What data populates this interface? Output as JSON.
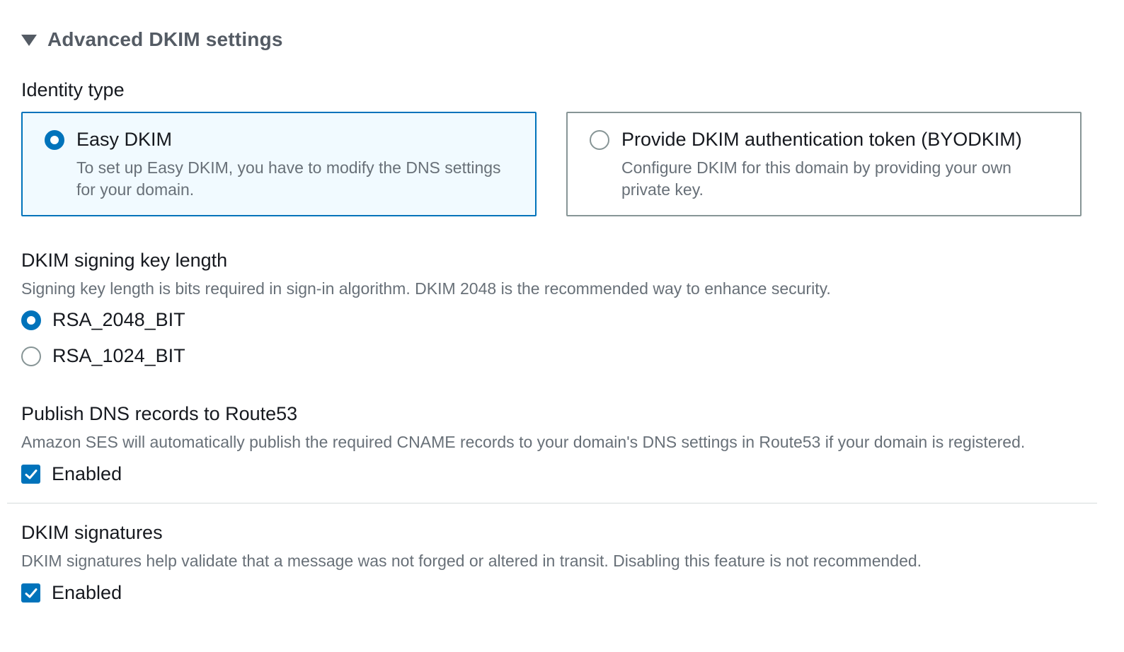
{
  "section": {
    "title": "Advanced DKIM settings"
  },
  "identity_type": {
    "label": "Identity type",
    "options": [
      {
        "title": "Easy DKIM",
        "description": "To set up Easy DKIM, you have to modify the DNS settings for your domain.",
        "selected": true
      },
      {
        "title": "Provide DKIM authentication token (BYODKIM)",
        "description": "Configure DKIM for this domain by providing your own private key.",
        "selected": false
      }
    ]
  },
  "key_length": {
    "label": "DKIM signing key length",
    "description": "Signing key length is bits required in sign-in algorithm. DKIM 2048 is the recommended way to enhance security.",
    "options": [
      {
        "label": "RSA_2048_BIT",
        "selected": true
      },
      {
        "label": "RSA_1024_BIT",
        "selected": false
      }
    ]
  },
  "publish_dns": {
    "label": "Publish DNS records to Route53",
    "description": "Amazon SES will automatically publish the required CNAME records to your domain's DNS settings in Route53 if your domain is registered.",
    "checkbox_label": "Enabled",
    "checked": true
  },
  "dkim_signatures": {
    "label": "DKIM signatures",
    "description": "DKIM signatures help validate that a message was not forged or altered in transit. Disabling this feature is not recommended.",
    "checkbox_label": "Enabled",
    "checked": true
  },
  "colors": {
    "accent": "#0073bb",
    "selected_tile_bg": "#f1faff",
    "muted_text": "#687078",
    "heading_text": "#545b64"
  }
}
